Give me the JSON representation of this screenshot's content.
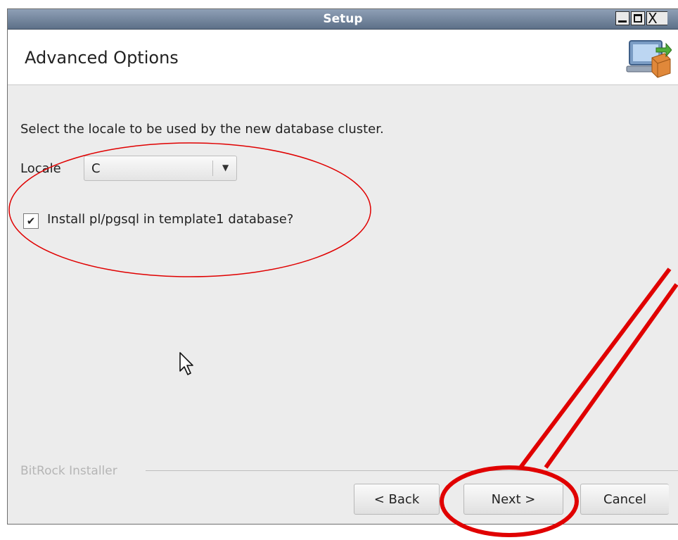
{
  "window": {
    "title": "Setup",
    "controls": {
      "minimize": "minimize-icon",
      "maximize": "maximize-icon",
      "close": "close-icon"
    },
    "close_glyph": "X"
  },
  "header": {
    "title": "Advanced Options",
    "logo_icon": "installer-computer-icon"
  },
  "body": {
    "instruction": "Select the locale to be used by the new database cluster.",
    "locale_label": "Locale",
    "locale_value": "C",
    "checkbox_label": "Install pl/pgsql in template1 database?",
    "checkbox_checked": true,
    "checkbox_glyph": "✔"
  },
  "footer": {
    "brand": "BitRock Installer",
    "back_label": "< Back",
    "next_label": "Next >",
    "cancel_label": "Cancel"
  },
  "annotations": {
    "color": "#e00000",
    "shapes": [
      "ellipse-around-options",
      "ellipse-around-next",
      "arrow-to-next"
    ]
  }
}
